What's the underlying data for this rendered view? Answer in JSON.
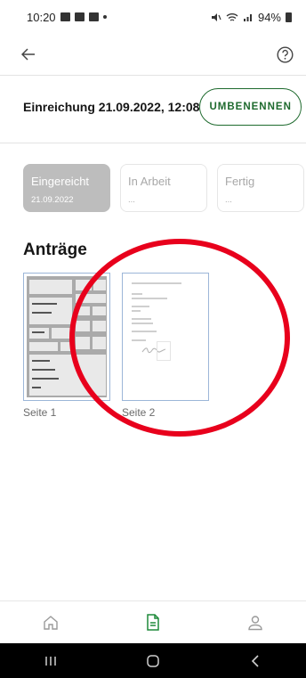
{
  "status_bar": {
    "time": "10:20",
    "battery": "94%"
  },
  "header": {
    "title": "Einreichung 21.09.2022, 12:08",
    "rename_label": "UMBENENNEN"
  },
  "status_cards": [
    {
      "title": "Eingereicht",
      "sub": "21.09.2022",
      "active": true
    },
    {
      "title": "In Arbeit",
      "sub": "...",
      "active": false
    },
    {
      "title": "Fertig",
      "sub": "...",
      "active": false
    }
  ],
  "section": {
    "title": "Anträge"
  },
  "pages": [
    {
      "label": "Seite 1"
    },
    {
      "label": "Seite 2"
    }
  ],
  "icons": {
    "back": "arrow-left-icon",
    "help": "help-circle-icon",
    "home": "home-icon",
    "documents": "document-icon",
    "profile": "person-icon"
  },
  "colors": {
    "accent": "#1e6a2e",
    "annotation": "#e8001c",
    "active_card": "#bdbdbd"
  }
}
